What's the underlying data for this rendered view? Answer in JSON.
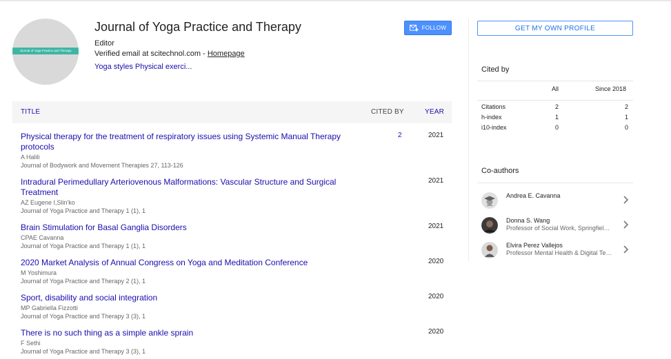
{
  "profile": {
    "avatar_label": "Journal of Yoga Practice and Therapy",
    "name": "Journal of Yoga Practice and Therapy",
    "affiliation": "Editor",
    "email_text": "Verified email at scitechnol.com - ",
    "homepage_label": "Homepage",
    "interests": "Yoga styles Physical exerci...",
    "follow_label": "FOLLOW",
    "follow_icon": "mail-plus-icon"
  },
  "table": {
    "col_title": "TITLE",
    "col_cited": "CITED BY",
    "col_year": "YEAR",
    "rows": [
      {
        "title": "Physical therapy for the treatment of respiratory issues using Systemic Manual Therapy protocols",
        "authors": "A Halili",
        "source": "Journal of Bodywork and Movement Therapies 27, 113-126",
        "cited": "2",
        "year": "2021"
      },
      {
        "title": "Intradural Perimedullary Arteriovenous Malformations: Vascular Structure and Surgical Treatment",
        "authors": "AZ Eugene I,Slin'ko",
        "source": "Journal of Yoga Practice and Therapy 1 (1), 1",
        "cited": "",
        "year": "2021"
      },
      {
        "title": "Brain Stimulation for Basal Ganglia Disorders",
        "authors": "CPAE Cavanna",
        "source": "Journal of Yoga Practice and Therapy 1 (1), 1",
        "cited": "",
        "year": "2021"
      },
      {
        "title": "2020 Market Analysis of Annual Congress on Yoga and Meditation Conference",
        "authors": "M Yoshimura",
        "source": "Journal of Yoga Practice and Therapy 2 (1), 1",
        "cited": "",
        "year": "2020"
      },
      {
        "title": "Sport, disability and social integration",
        "authors": "MP Gabriella Fizzotti",
        "source": "Journal of Yoga Practice and Therapy 3 (3), 1",
        "cited": "",
        "year": "2020"
      },
      {
        "title": "There is no such thing as a simple ankle sprain",
        "authors": "F Sethi",
        "source": "Journal of Yoga Practice and Therapy 3 (3), 1",
        "cited": "",
        "year": "2020"
      }
    ]
  },
  "sidebar": {
    "get_profile_label": "GET MY OWN PROFILE",
    "cited_by_heading": "Cited by",
    "col_all": "All",
    "col_since": "Since 2018",
    "metrics": [
      {
        "label": "Citations",
        "all": "2",
        "since": "2"
      },
      {
        "label": "h-index",
        "all": "1",
        "since": "1"
      },
      {
        "label": "i10-index",
        "all": "0",
        "since": "0"
      }
    ],
    "coauthors_heading": "Co-authors",
    "coauthors": [
      {
        "name": "Andrea E. Cavanna",
        "affiliation": ""
      },
      {
        "name": "Donna S. Wang",
        "affiliation": "Professor of Social Work, Springfield College"
      },
      {
        "name": "Elvira Perez Vallejos",
        "affiliation": "Professor Mental Health & Digital Technology"
      }
    ]
  },
  "colors": {
    "link": "#1a0dab",
    "button": "#4d90fe",
    "avatar_band": "#3fb5a5"
  }
}
